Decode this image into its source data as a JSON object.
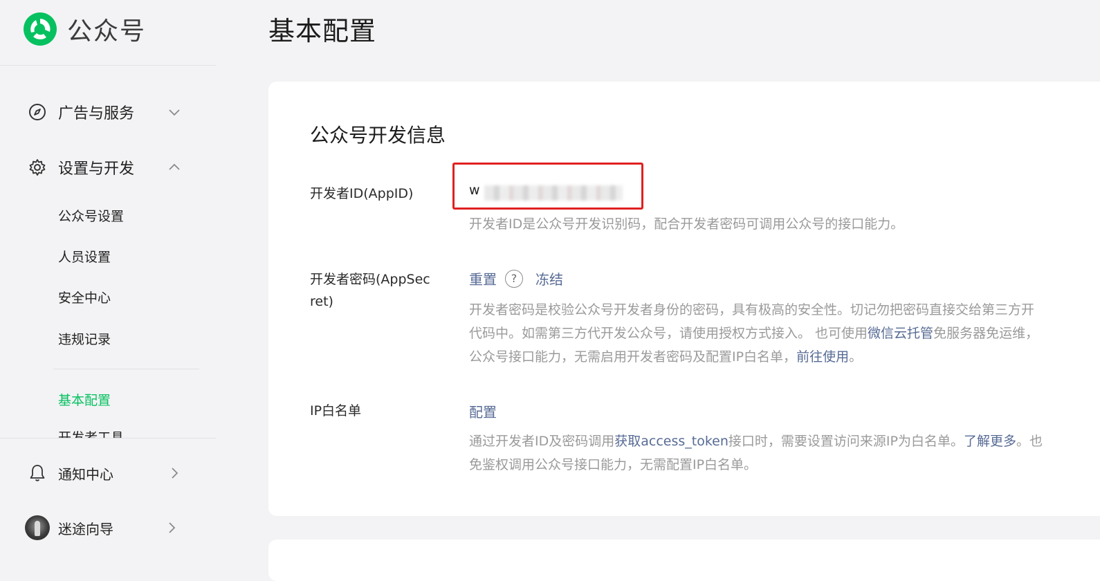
{
  "brand": {
    "name": "公众号"
  },
  "sidebar": {
    "groups": [
      {
        "label": "广告与服务",
        "icon": "compass-icon",
        "expanded": false
      },
      {
        "label": "设置与开发",
        "icon": "gear-icon",
        "expanded": true
      }
    ],
    "sub_items": [
      "公众号设置",
      "人员设置",
      "安全中心",
      "违规记录"
    ],
    "active_item": "基本配置",
    "cut_item": "开发者工具",
    "bottom": [
      {
        "label": "通知中心",
        "icon": "bell-icon"
      },
      {
        "label": "迷途向导",
        "icon": "avatar"
      }
    ]
  },
  "page": {
    "title": "基本配置"
  },
  "dev_info": {
    "title": "公众号开发信息",
    "appid": {
      "label": "开发者ID(AppID)",
      "value": "w",
      "desc": "开发者ID是公众号开发识别码，配合开发者密码可调用公众号的接口能力。"
    },
    "appsecret": {
      "label_line1": "开发者密码(AppSec",
      "label_line2": "ret)",
      "reset": "重置",
      "help": "?",
      "freeze": "冻结",
      "desc_line1": "开发者密码是校验公众号开发者身份的密码，具有极高的安全性。切记勿把密码直接交给第三方开",
      "desc_line2_a": "代码中。如需第三方代开发公众号，请使用授权方式接入。 也可使用",
      "desc_line2_link": "微信云托管",
      "desc_line2_b": "免服务器免运维，",
      "desc_line3_a": "公众号接口能力，无需启用开发者密码及配置IP白名单，",
      "desc_line3_link": "前往使用",
      "desc_line3_b": "。"
    },
    "ip_whitelist": {
      "label": "IP白名单",
      "config": "配置",
      "desc_line1_a": "通过开发者ID及密码调用",
      "desc_line1_link": "获取access_token",
      "desc_line1_b": "接口时，需要设置访问来源IP为白名单。",
      "desc_line1_link2": "了解更多",
      "desc_line1_c": "。也",
      "desc_line2": "免鉴权调用公众号接口能力，无需配置IP白名单。"
    }
  },
  "colors": {
    "accent": "#07c160",
    "link": "#576b95",
    "highlight": "#e02020"
  }
}
